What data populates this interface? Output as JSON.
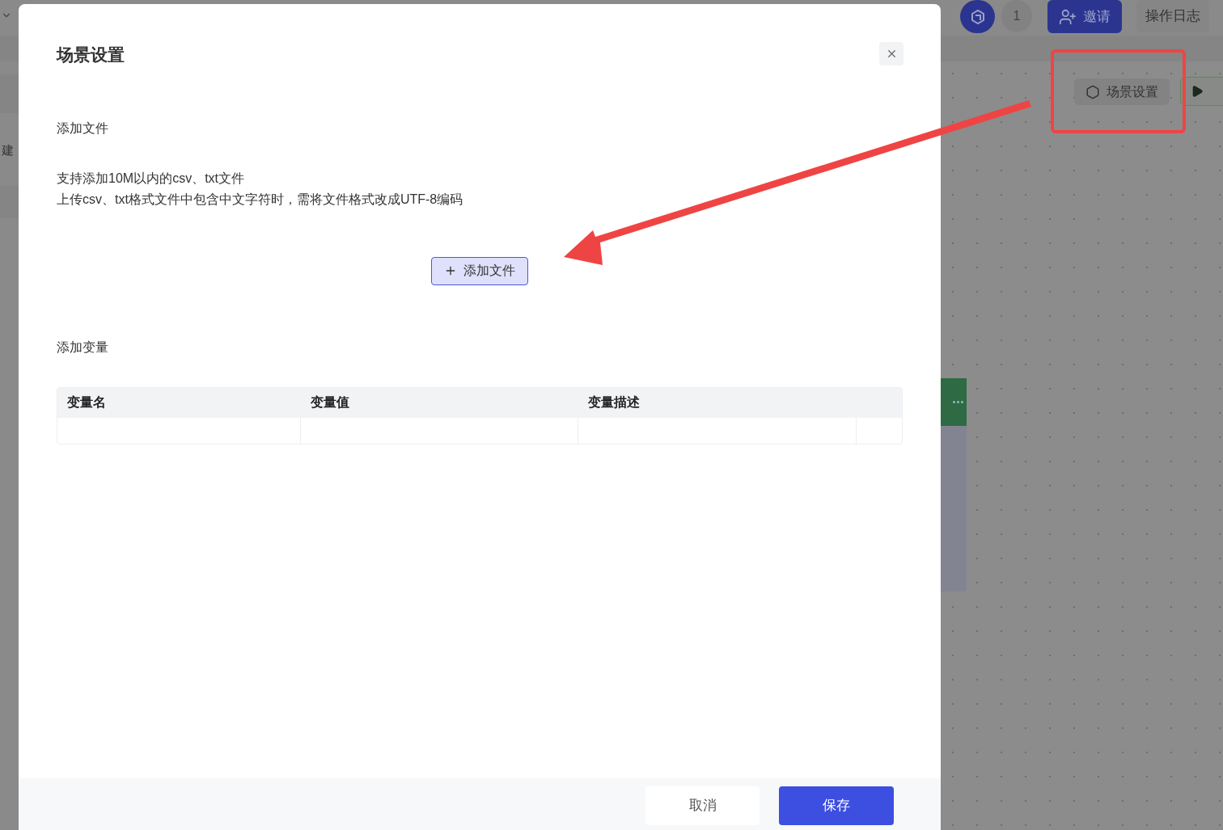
{
  "background": {
    "sidebar_label": "建",
    "badge_count": "1",
    "invite_button": "邀请",
    "log_button": "操作日志",
    "scene_button": "场景设置"
  },
  "dialog": {
    "title": "场景设置",
    "file_section": {
      "heading": "添加文件",
      "notes": [
        "支持添加10M以内的csv、txt文件",
        "上传csv、txt格式文件中包含中文字符时，需将文件格式改成UTF-8编码"
      ],
      "add_button": "添加文件"
    },
    "variable_section": {
      "heading": "添加变量",
      "columns": [
        "变量名",
        "变量值",
        "变量描述"
      ]
    },
    "buttons": [
      {
        "label": "取消",
        "kind": "secondary"
      },
      {
        "label": "保存",
        "kind": "primary"
      }
    ]
  }
}
